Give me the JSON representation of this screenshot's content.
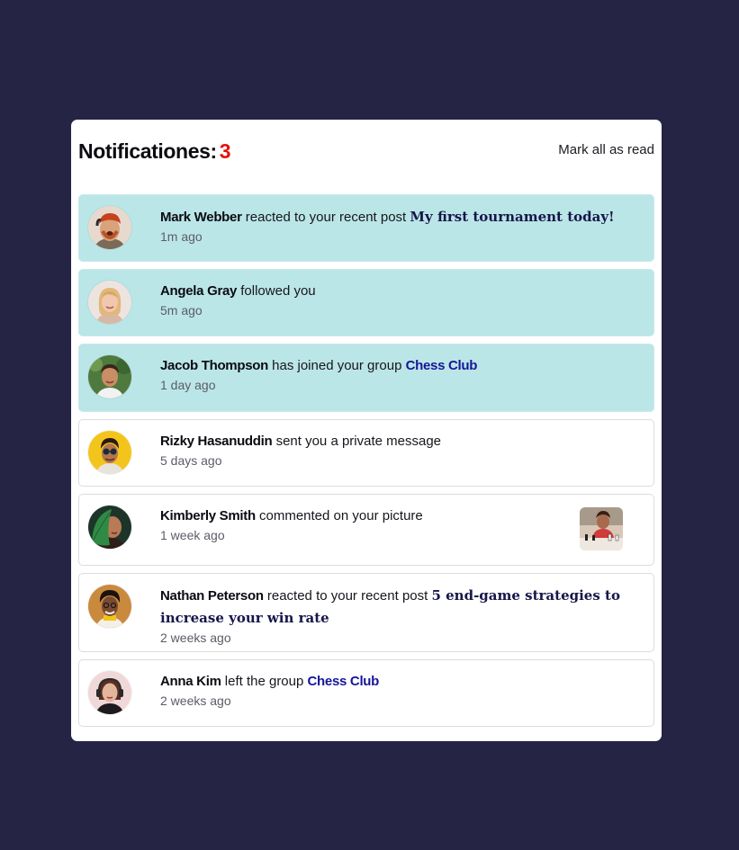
{
  "header": {
    "title": "Notificationes:",
    "count": "3",
    "mark_all": "Mark all as read"
  },
  "notifications": [
    {
      "name": "Mark Webber",
      "action": " reacted to your recent post ",
      "post": "My first tournament today!",
      "time": "1m ago",
      "unread": true,
      "avatar_icon": "man-shouting-avatar"
    },
    {
      "name": "Angela Gray",
      "action": " followed you",
      "time": "5m ago",
      "unread": true,
      "avatar_icon": "blonde-woman-avatar"
    },
    {
      "name": "Jacob Thompson",
      "action": " has joined your group ",
      "group": "Chess Club",
      "time": "1 day ago",
      "unread": true,
      "avatar_icon": "man-in-nature-avatar"
    },
    {
      "name": "Rizky Hasanuddin",
      "action": " sent you a private message",
      "time": "5 days ago",
      "unread": false,
      "avatar_icon": "man-sunglasses-avatar"
    },
    {
      "name": "Kimberly Smith",
      "action": " commented on your picture",
      "time": "1 week ago",
      "unread": false,
      "avatar_icon": "woman-with-leaf-avatar",
      "picture_icon": "chess-picture-thumbnail"
    },
    {
      "name": "Nathan Peterson",
      "action": " reacted to your recent post ",
      "post": "5 end-game strategies to increase your win rate",
      "time": "2 weeks ago",
      "unread": false,
      "avatar_icon": "man-curly-hair-avatar"
    },
    {
      "name": "Anna Kim",
      "action": " left the group ",
      "group": "Chess Club",
      "time": "2 weeks ago",
      "unread": false,
      "avatar_icon": "woman-headphones-avatar"
    }
  ],
  "colors": {
    "page_background": "#262445",
    "card_background": "#ffffff",
    "unread_background": "#bbe6e7",
    "count_red": "#e3130f",
    "group_link_blue": "#16169a"
  }
}
